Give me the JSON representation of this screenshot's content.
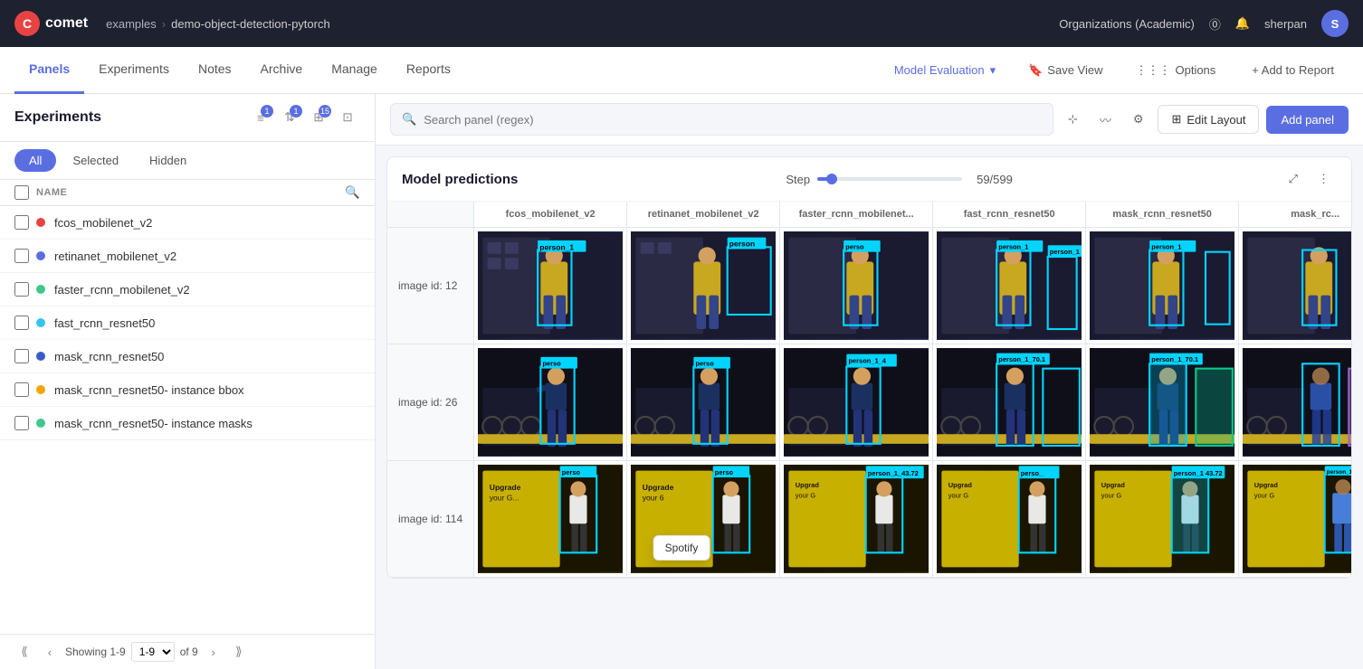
{
  "topnav": {
    "logo_text": "comet",
    "breadcrumb_examples": "examples",
    "breadcrumb_sep": ">",
    "breadcrumb_current": "demo-object-detection-pytorch",
    "org_label": "Organizations (Academic)",
    "user": "sherpan"
  },
  "secondnav": {
    "tabs": [
      {
        "id": "panels",
        "label": "Panels",
        "active": true
      },
      {
        "id": "experiments",
        "label": "Experiments"
      },
      {
        "id": "notes",
        "label": "Notes"
      },
      {
        "id": "archive",
        "label": "Archive"
      },
      {
        "id": "manage",
        "label": "Manage"
      },
      {
        "id": "reports",
        "label": "Reports"
      }
    ],
    "model_eval_label": "Model Evaluation",
    "save_view_label": "Save View",
    "options_label": "Options",
    "add_to_report_label": "+ Add to Report"
  },
  "sidebar": {
    "title": "Experiments",
    "filter_tabs": [
      "All",
      "Selected",
      "Hidden"
    ],
    "active_filter": "All",
    "name_col": "NAME",
    "experiments": [
      {
        "id": 1,
        "name": "fcos_mobilenet_v2",
        "color": "#e84343"
      },
      {
        "id": 2,
        "name": "retinanet_mobilenet_v2",
        "color": "#5b6ee1"
      },
      {
        "id": 3,
        "name": "faster_rcnn_mobilenet_v2",
        "color": "#40c88a"
      },
      {
        "id": 4,
        "name": "fast_rcnn_resnet50",
        "color": "#36c5f0"
      },
      {
        "id": 5,
        "name": "mask_rcnn_resnet50",
        "color": "#3a5bc7"
      },
      {
        "id": 6,
        "name": "mask_rcnn_resnet50- instance bbox",
        "color": "#f0a500"
      },
      {
        "id": 7,
        "name": "mask_rcnn_resnet50- instance masks",
        "color": "#40c88a"
      }
    ],
    "pagination": {
      "showing": "Showing 1-9",
      "of": "of 9"
    }
  },
  "panel": {
    "title": "Model predictions",
    "step_label": "Step",
    "step_value": "59/599",
    "search_placeholder": "Search panel (regex)",
    "edit_layout_label": "Edit Layout",
    "add_panel_label": "Add panel",
    "columns": [
      {
        "id": "fcos",
        "label": "fcos_mobilenet_v2"
      },
      {
        "id": "retina",
        "label": "retinanet_mobilenet_v2"
      },
      {
        "id": "faster",
        "label": "faster_rcnn_mobilenet..."
      },
      {
        "id": "fast",
        "label": "fast_rcnn_resnet50"
      },
      {
        "id": "mask",
        "label": "mask_rcnn_resnet50"
      },
      {
        "id": "mask2",
        "label": "mask_rc..."
      }
    ],
    "rows": [
      {
        "id": "row1",
        "label": "image id: 12"
      },
      {
        "id": "row2",
        "label": "image id: 26"
      },
      {
        "id": "row3",
        "label": "image id: 114"
      }
    ],
    "tooltip": "Spotify"
  }
}
